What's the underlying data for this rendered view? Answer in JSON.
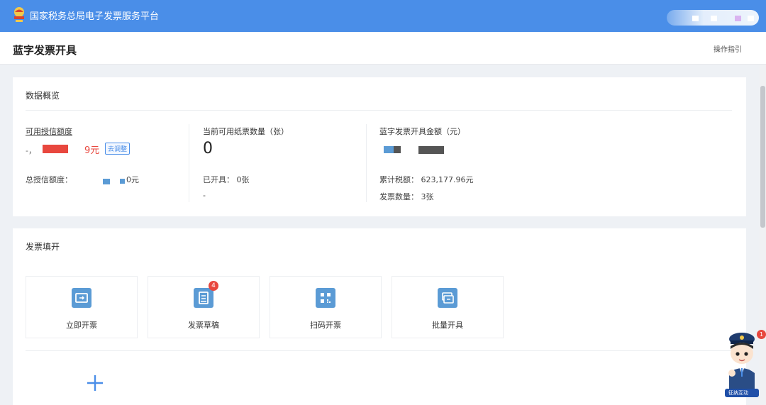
{
  "header": {
    "platform_title": "国家税务总局电子发票服务平台"
  },
  "page": {
    "title": "蓝字发票开具",
    "guide_link": "操作指引"
  },
  "overview": {
    "section_title": "数据概览",
    "credit": {
      "label": "可用授信额度",
      "value_visible": "-，",
      "value_suffix": "9元",
      "adjust_button": "去调整",
      "total_label": "总授信额度：",
      "total_suffix": "0元"
    },
    "paper": {
      "label": "当前可用纸票数量（张）",
      "value": "0",
      "issued": "已开具： 0张",
      "dash": "-"
    },
    "blue": {
      "label": "蓝字发票开具金额（元）",
      "tax_total": "累计税额： 623,177.96元",
      "invoice_count": "发票数量： 3张"
    }
  },
  "fill": {
    "section_title": "发票填开",
    "tiles": [
      {
        "label": "立即开票",
        "icon": "issue-ticket-icon"
      },
      {
        "label": "发票草稿",
        "icon": "draft-icon",
        "badge": "4"
      },
      {
        "label": "扫码开票",
        "icon": "qr-code-icon"
      },
      {
        "label": "批量开具",
        "icon": "batch-icon"
      }
    ],
    "add_icon": "plus-icon"
  },
  "assistant": {
    "badge": "1",
    "label": "征纳互动"
  },
  "colors": {
    "header_bg": "#4a8ee8",
    "accent": "#4a8ee8",
    "icon_blue": "#5b9bd5",
    "badge_red": "#e8473e"
  }
}
